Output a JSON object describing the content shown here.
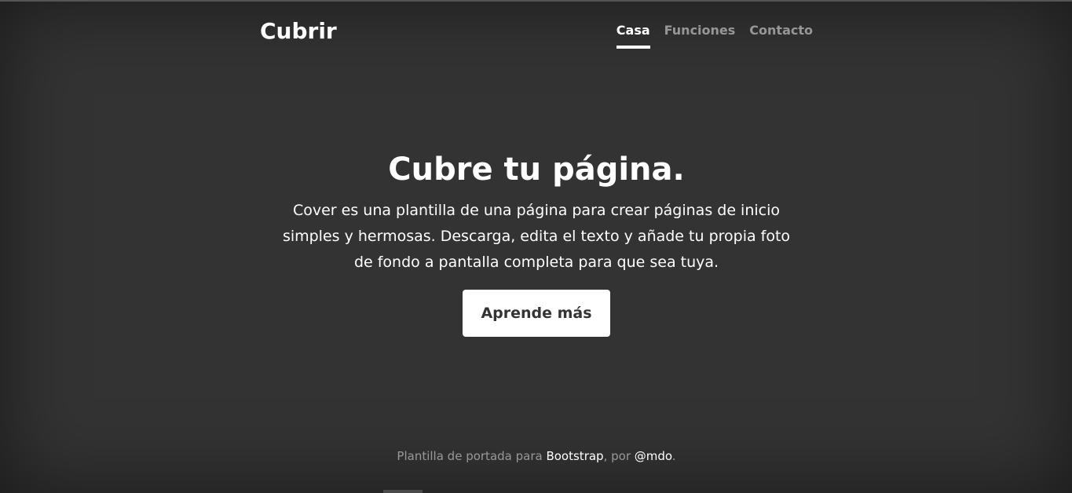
{
  "header": {
    "brand": "Cubrir",
    "nav": [
      {
        "label": "Casa",
        "active": true
      },
      {
        "label": "Funciones",
        "active": false
      },
      {
        "label": "Contacto",
        "active": false
      }
    ]
  },
  "hero": {
    "title": "Cubre tu página.",
    "lead": "Cover es una plantilla de una página para crear páginas de inicio simples y hermosas. Descarga, edita el texto y añade tu propia foto de fondo a pantalla completa para que sea tuya.",
    "button_label": "Aprende más"
  },
  "footer": {
    "prefix": "Plantilla de portada para ",
    "link1": "Bootstrap",
    "middle": ", por ",
    "link2": "@mdo",
    "suffix": "."
  },
  "colors": {
    "background": "#333333",
    "text": "#ffffff",
    "muted": "rgba(255,255,255,0.5)"
  }
}
